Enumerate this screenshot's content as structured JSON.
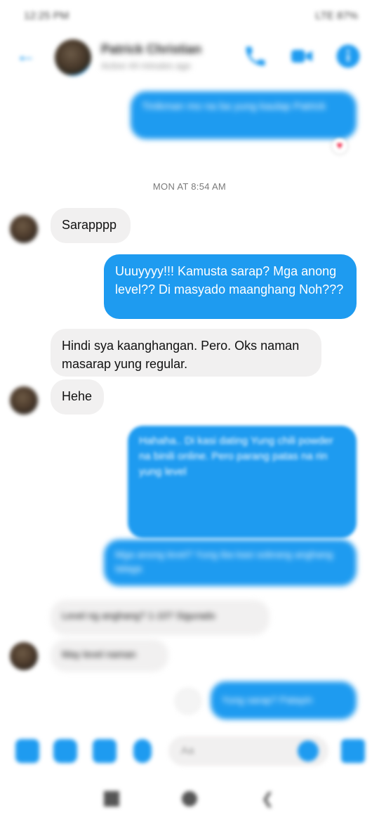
{
  "status_bar": {
    "left": "12:25 PM",
    "right": "LTE 87%"
  },
  "header": {
    "contact_name": "Patrick Christian",
    "contact_status": "Active 44 minutes ago"
  },
  "messages": {
    "m0": "Tinikman mo na ba yung kaulap Patrick",
    "timestamp": "MON AT 8:54 AM",
    "m1": "Sarapppp",
    "m2": "Uuuyyyy!!! Kamusta sarap? Mga anong level?? Di masyado maanghang Noh???",
    "m3": "Hindi sya kaanghangan. Pero. Oks naman masarap yung regular.",
    "m4": "Hehe",
    "m5": "Hahaha.. Di kasi dating Yung chili powder na binili online. Pero parang patas na rin yung level",
    "m6": "Mga anong level? Yung iba kasi sobrang anghang talaga",
    "m7": "Level ng anghang? 1-10? Sigurado",
    "m8": "May level naman",
    "m9": "Yung sarap? Patayin"
  },
  "composer": {
    "placeholder": "Aa"
  }
}
